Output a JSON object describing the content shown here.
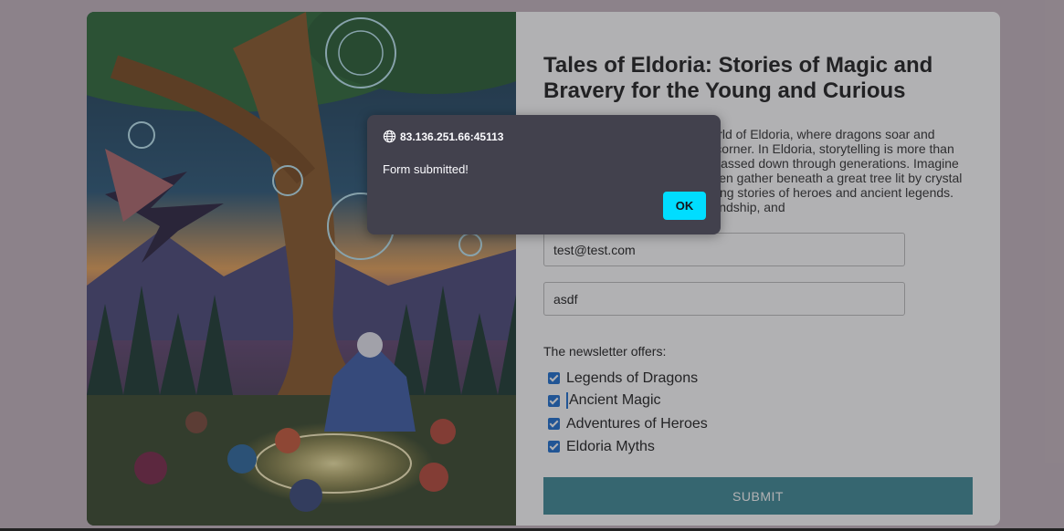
{
  "page": {
    "title": "Tales of Eldoria: Stories of Magic and Bravery for the Young and Curious",
    "description": "Welcome to the enchanting world of Eldoria, where dragons soar and ancient magic thrives in every corner. In Eldoria, storytelling is more than just a pastime—it's a tradition passed down through generations. Imagine a magical evening where children gather beneath a great tree lit by crystal orbs, listening to the mesmerizing stories of heroes and ancient legends. These tales teach courage, friendship, and",
    "image_alt": "Pixel-art illustration of a storyteller under a glowing magical tree with children and a dragon"
  },
  "form": {
    "email_value": "test@test.com",
    "name_value": "asdf",
    "offers_label": "The newsletter offers:",
    "offers": [
      {
        "label": "Legends of Dragons",
        "checked": true
      },
      {
        "label": "Ancient Magic",
        "checked": true
      },
      {
        "label": "Adventures of Heroes",
        "checked": true
      },
      {
        "label": "Eldoria Myths",
        "checked": true
      }
    ],
    "submit_label": "SUBMIT"
  },
  "dialog": {
    "origin": "83.136.251.66:45113",
    "message": "Form submitted!",
    "ok_label": "OK",
    "icon": "globe-icon"
  },
  "colors": {
    "dialog_bg": "#42414d",
    "ok_button": "#00ddff",
    "submit_button": "#3f8a96",
    "checkbox": "#1f6fd1"
  }
}
